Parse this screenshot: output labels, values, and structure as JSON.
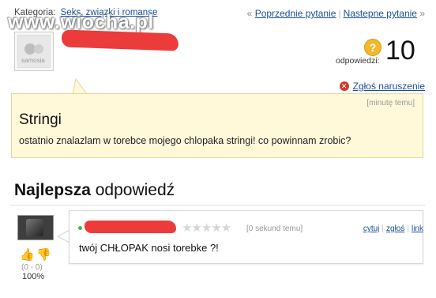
{
  "category": {
    "label": "Kategoria:",
    "link": "Seks, związki i romanse"
  },
  "watermark": "www.wiocha.pl",
  "nav": {
    "prev": "Poprzednie pytanie",
    "next": "Nastepne pytanie",
    "prefix": "«",
    "suffix": "»"
  },
  "avatar": {
    "text": "samosia"
  },
  "answers": {
    "label": "odpowiedzi:",
    "count": "10",
    "icon": "question-icon"
  },
  "report": {
    "label": "Zgłoś naruszenie",
    "icon": "x-circle-icon"
  },
  "question": {
    "time": "[minutę temu]",
    "title": "Stringi",
    "text": "ostatnio znalazlam w torebce mojego chlopaka stringi! co powinnam zrobic?"
  },
  "best": {
    "bold": "Najlepsza",
    "rest": "odpowiedź"
  },
  "answer": {
    "stars": "★★★★★",
    "time": "[0 sekund temu]",
    "actions": {
      "quote": "cytuj",
      "report": "zgłoś",
      "link": "link"
    },
    "text": "twój CHŁOPAK nosi torebke ?!",
    "votes": "(0 - 0)",
    "percent": "100%"
  },
  "colors": {
    "link": "#1a4f9c",
    "question_bg": "#fff8d9",
    "redaction": "#ec3b3b",
    "accent": "#f2b82e"
  }
}
